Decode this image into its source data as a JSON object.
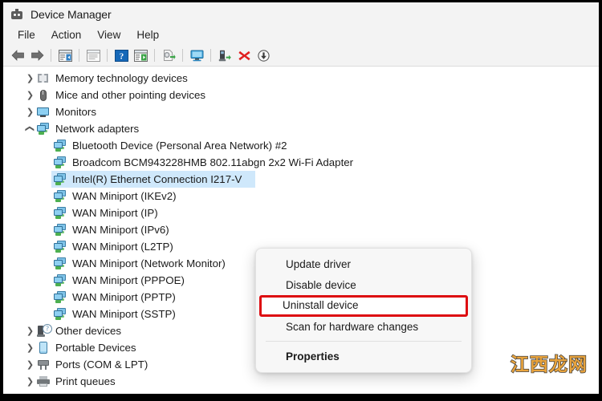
{
  "window": {
    "title": "Device Manager",
    "icon": "device-manager-icon"
  },
  "menubar": {
    "items": [
      {
        "label": "File"
      },
      {
        "label": "Action"
      },
      {
        "label": "View"
      },
      {
        "label": "Help"
      }
    ]
  },
  "toolbar": {
    "buttons": [
      {
        "name": "back-button",
        "icon": "left-arrow-icon"
      },
      {
        "name": "forward-button",
        "icon": "right-arrow-icon"
      },
      {
        "name": "separator-1",
        "icon": "separator"
      },
      {
        "name": "show-hide-console-tree-button",
        "icon": "console-tree-icon"
      },
      {
        "name": "separator-2",
        "icon": "separator"
      },
      {
        "name": "properties-button",
        "icon": "properties-window-icon"
      },
      {
        "name": "separator-3",
        "icon": "separator"
      },
      {
        "name": "help-button",
        "icon": "help-question-icon"
      },
      {
        "name": "show-hide-action-pane-button",
        "icon": "action-pane-icon"
      },
      {
        "name": "separator-4",
        "icon": "separator"
      },
      {
        "name": "update-driver-button",
        "icon": "update-driver-icon"
      },
      {
        "name": "separator-5",
        "icon": "separator"
      },
      {
        "name": "scan-hardware-changes-button",
        "icon": "scan-monitor-icon"
      },
      {
        "name": "separator-6",
        "icon": "separator"
      },
      {
        "name": "enable-device-button",
        "icon": "enable-device-icon"
      },
      {
        "name": "uninstall-device-button",
        "icon": "red-x-icon"
      },
      {
        "name": "disable-device-button",
        "icon": "down-arrow-circle-icon"
      }
    ]
  },
  "tree": {
    "rows": [
      {
        "level": 1,
        "twisty": "collapsed",
        "icon": "memory-technology-icon",
        "label": "Memory technology devices",
        "selected": false
      },
      {
        "level": 1,
        "twisty": "collapsed",
        "icon": "mouse-icon",
        "label": "Mice and other pointing devices",
        "selected": false
      },
      {
        "level": 1,
        "twisty": "collapsed",
        "icon": "monitor-icon",
        "label": "Monitors",
        "selected": false
      },
      {
        "level": 1,
        "twisty": "expanded",
        "icon": "network-adapter-icon",
        "label": "Network adapters",
        "selected": false
      },
      {
        "level": 2,
        "twisty": "none",
        "icon": "network-adapter-icon",
        "label": "Bluetooth Device (Personal Area Network) #2",
        "selected": false
      },
      {
        "level": 2,
        "twisty": "none",
        "icon": "network-adapter-icon",
        "label": "Broadcom BCM943228HMB 802.11abgn 2x2 Wi-Fi Adapter",
        "selected": false
      },
      {
        "level": 2,
        "twisty": "none",
        "icon": "network-adapter-icon",
        "label": "Intel(R) Ethernet Connection I217-V",
        "selected": true
      },
      {
        "level": 2,
        "twisty": "none",
        "icon": "network-adapter-icon",
        "label": "WAN Miniport (IKEv2)",
        "selected": false
      },
      {
        "level": 2,
        "twisty": "none",
        "icon": "network-adapter-icon",
        "label": "WAN Miniport (IP)",
        "selected": false
      },
      {
        "level": 2,
        "twisty": "none",
        "icon": "network-adapter-icon",
        "label": "WAN Miniport (IPv6)",
        "selected": false
      },
      {
        "level": 2,
        "twisty": "none",
        "icon": "network-adapter-icon",
        "label": "WAN Miniport (L2TP)",
        "selected": false
      },
      {
        "level": 2,
        "twisty": "none",
        "icon": "network-adapter-icon",
        "label": "WAN Miniport (Network Monitor)",
        "selected": false
      },
      {
        "level": 2,
        "twisty": "none",
        "icon": "network-adapter-icon",
        "label": "WAN Miniport (PPPOE)",
        "selected": false
      },
      {
        "level": 2,
        "twisty": "none",
        "icon": "network-adapter-icon",
        "label": "WAN Miniport (PPTP)",
        "selected": false
      },
      {
        "level": 2,
        "twisty": "none",
        "icon": "network-adapter-icon",
        "label": "WAN Miniport (SSTP)",
        "selected": false
      },
      {
        "level": 1,
        "twisty": "collapsed",
        "icon": "other-devices-icon",
        "label": "Other devices",
        "selected": false
      },
      {
        "level": 1,
        "twisty": "collapsed",
        "icon": "portable-device-icon",
        "label": "Portable Devices",
        "selected": false
      },
      {
        "level": 1,
        "twisty": "collapsed",
        "icon": "ports-icon",
        "label": "Ports (COM & LPT)",
        "selected": false
      },
      {
        "level": 1,
        "twisty": "collapsed",
        "icon": "printer-icon",
        "label": "Print queues",
        "selected": false
      }
    ],
    "selection_color": "#cfe8fb"
  },
  "context_menu": {
    "items": [
      {
        "label": "Update driver",
        "bold": false,
        "highlighted": false
      },
      {
        "label": "Disable device",
        "bold": false,
        "highlighted": false
      },
      {
        "label": "Uninstall device",
        "bold": false,
        "highlighted": true
      },
      {
        "label": "Scan for hardware changes",
        "bold": false,
        "highlighted": false
      },
      {
        "label": "Properties",
        "bold": true,
        "highlighted": false
      }
    ],
    "highlight_color": "#dd0b10"
  },
  "watermark": {
    "text": "江西龙网"
  }
}
